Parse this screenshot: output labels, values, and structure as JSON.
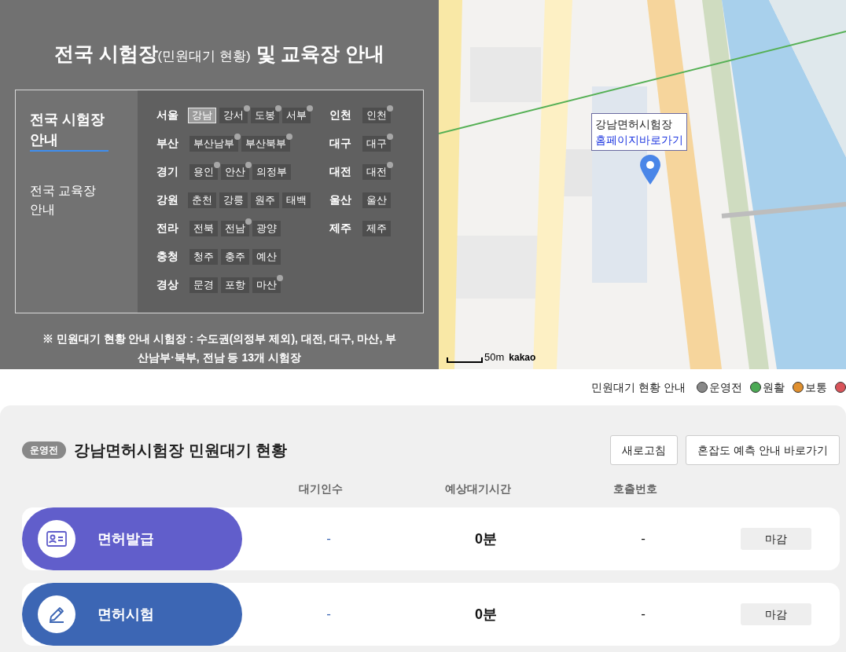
{
  "intro": {
    "title": "전국 시험장",
    "title_sub": "(민원대기 현황)",
    "title_end": "및 교육장 안내",
    "nav": [
      {
        "label": "전국 시험장 안내",
        "selected": true
      },
      {
        "label": "전국 교육장 안내",
        "selected": false
      }
    ],
    "columns": [
      [
        {
          "region": "서울",
          "centers": [
            {
              "label": "강남",
              "selected": true,
              "dot": false
            },
            {
              "label": "강서",
              "selected": false,
              "dot": true
            },
            {
              "label": "도봉",
              "selected": false,
              "dot": true
            },
            {
              "label": "서부",
              "selected": false,
              "dot": true
            }
          ]
        },
        {
          "region": "부산",
          "centers": [
            {
              "label": "부산남부",
              "selected": false,
              "dot": true
            },
            {
              "label": "부산북부",
              "selected": false,
              "dot": true
            }
          ]
        },
        {
          "region": "경기",
          "centers": [
            {
              "label": "용인",
              "selected": false,
              "dot": true
            },
            {
              "label": "안산",
              "selected": false,
              "dot": true
            },
            {
              "label": "의정부",
              "selected": false,
              "dot": false
            }
          ]
        },
        {
          "region": "강원",
          "centers": [
            {
              "label": "춘천",
              "selected": false,
              "dot": false
            },
            {
              "label": "강릉",
              "selected": false,
              "dot": false
            },
            {
              "label": "원주",
              "selected": false,
              "dot": false
            },
            {
              "label": "태백",
              "selected": false,
              "dot": false
            }
          ]
        },
        {
          "region": "전라",
          "centers": [
            {
              "label": "전북",
              "selected": false,
              "dot": false
            },
            {
              "label": "전남",
              "selected": false,
              "dot": true
            },
            {
              "label": "광양",
              "selected": false,
              "dot": false
            }
          ]
        },
        {
          "region": "충청",
          "centers": [
            {
              "label": "청주",
              "selected": false,
              "dot": false
            },
            {
              "label": "충주",
              "selected": false,
              "dot": false
            },
            {
              "label": "예산",
              "selected": false,
              "dot": false
            }
          ]
        },
        {
          "region": "경상",
          "centers": [
            {
              "label": "문경",
              "selected": false,
              "dot": false
            },
            {
              "label": "포항",
              "selected": false,
              "dot": false
            },
            {
              "label": "마산",
              "selected": false,
              "dot": true
            }
          ]
        }
      ],
      [
        {
          "region": "인천",
          "centers": [
            {
              "label": "인천",
              "selected": false,
              "dot": true
            }
          ]
        },
        {
          "region": "대구",
          "centers": [
            {
              "label": "대구",
              "selected": false,
              "dot": true
            }
          ]
        },
        {
          "region": "대전",
          "centers": [
            {
              "label": "대전",
              "selected": false,
              "dot": true
            }
          ]
        },
        {
          "region": "울산",
          "centers": [
            {
              "label": "울산",
              "selected": false,
              "dot": false
            }
          ]
        },
        {
          "region": "제주",
          "centers": [
            {
              "label": "제주",
              "selected": false,
              "dot": false
            }
          ]
        }
      ]
    ],
    "note": "※ 민원대기 현황 안내 시험장 : 수도권(의정부 제외), 대전, 대구, 마산, 부산남부·북부, 전남 등 13개 시험장"
  },
  "map": {
    "kind": "picture",
    "info_title": "강남면허시험장",
    "info_link": "홈페이지바로가기",
    "scale": "50m",
    "brand": "kakao"
  },
  "legend": {
    "title": "민원대기 현황 안내",
    "items": [
      {
        "label": "운영전",
        "color": "#888888"
      },
      {
        "label": "원활",
        "color": "#4caa55"
      },
      {
        "label": "보통",
        "color": "#e0902f"
      },
      {
        "color": "#d9545a"
      }
    ]
  },
  "status": {
    "badge": "운영전",
    "title": "강남면허시험장 민원대기 현황",
    "buttons": [
      "새로고침",
      "혼잡도 예측 안내 바로가기"
    ],
    "columns": [
      "대기인수",
      "예상대기시간",
      "호출번호"
    ],
    "rows": [
      {
        "kind": "issue",
        "name": "면허발급",
        "color": "#615ecb",
        "waiting": "-",
        "time": "0분",
        "call": "-",
        "state": "마감"
      },
      {
        "kind": "exam",
        "name": "면허시험",
        "color": "#3c66b4",
        "waiting": "-",
        "time": "0분",
        "call": "-",
        "state": "마감"
      }
    ]
  }
}
